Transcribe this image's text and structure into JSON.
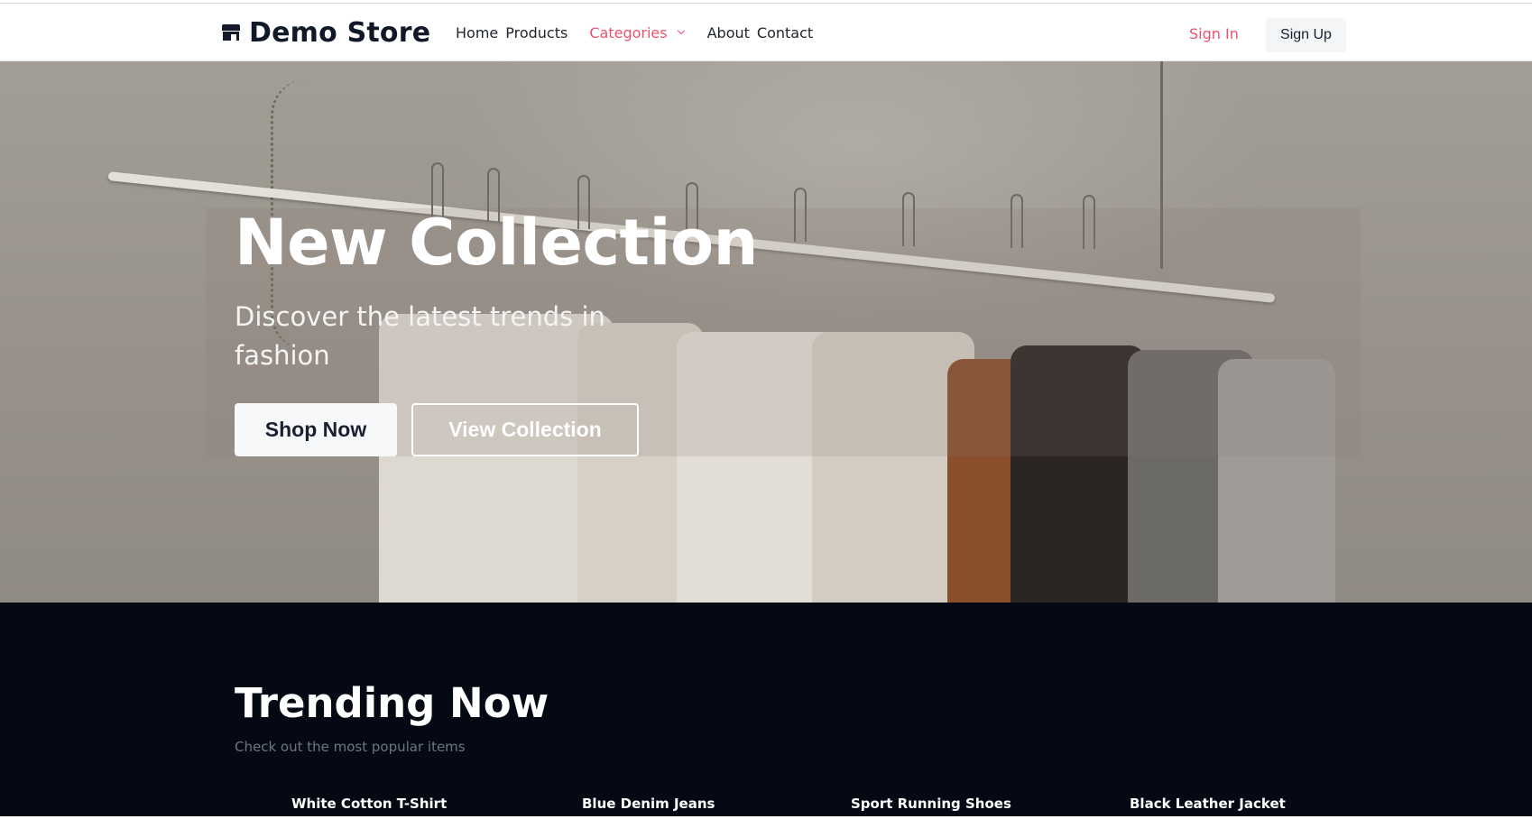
{
  "header": {
    "brand": "Demo Store",
    "nav": [
      {
        "label": "Home"
      },
      {
        "label": "Products"
      },
      {
        "label": "Categories"
      },
      {
        "label": "About"
      },
      {
        "label": "Contact"
      }
    ],
    "sign_in": "Sign In",
    "sign_up": "Sign Up",
    "accent_color": "#e8546f"
  },
  "hero": {
    "title": "New Collection",
    "subtitle": "Discover the latest trends in fashion",
    "primary_button": "Shop Now",
    "secondary_button": "View Collection"
  },
  "trending": {
    "title": "Trending Now",
    "subtitle": "Check out the most popular items",
    "products": [
      {
        "name": "White Cotton T-Shirt"
      },
      {
        "name": "Blue Denim Jeans"
      },
      {
        "name": "Sport Running Shoes"
      },
      {
        "name": "Black Leather Jacket"
      }
    ]
  }
}
